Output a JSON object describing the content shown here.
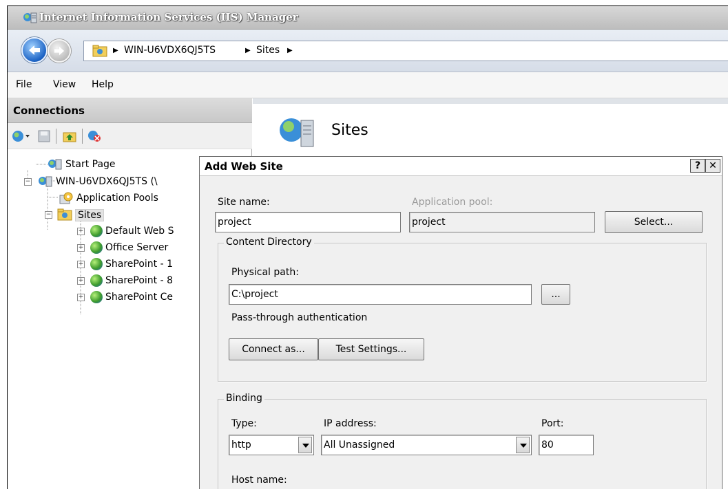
{
  "window": {
    "title": "Internet Information Services (IIS) Manager"
  },
  "address": {
    "crumbs": [
      "WIN-U6VDX6QJ5TS",
      "Sites"
    ]
  },
  "menu": [
    "File",
    "View",
    "Help"
  ],
  "connections": {
    "header": "Connections",
    "tree": {
      "start_page": "Start Page",
      "server": "WIN-U6VDX6QJ5TS (\\",
      "app_pools": "Application Pools",
      "sites": "Sites",
      "site_items": [
        "Default Web S",
        "Office Server",
        "SharePoint - 1",
        "SharePoint - 8",
        "SharePoint Ce"
      ]
    }
  },
  "main": {
    "title": "Sites"
  },
  "dialog": {
    "title": "Add Web Site",
    "help_label": "?",
    "close_label": "✕",
    "site_name_label": "Site name:",
    "site_name_value": "project",
    "app_pool_label": "Application pool:",
    "app_pool_value": "project",
    "select_label": "Select...",
    "content_group": "Content Directory",
    "physical_path_label": "Physical path:",
    "physical_path_value": "C:\\project",
    "browse_label": "...",
    "passthrough_label": "Pass-through authentication",
    "connect_as_label": "Connect as...",
    "test_settings_label": "Test Settings...",
    "binding_group": "Binding",
    "type_label": "Type:",
    "type_value": "http",
    "ip_label": "IP address:",
    "ip_value": "All Unassigned",
    "port_label": "Port:",
    "port_value": "80",
    "host_label": "Host name:"
  }
}
